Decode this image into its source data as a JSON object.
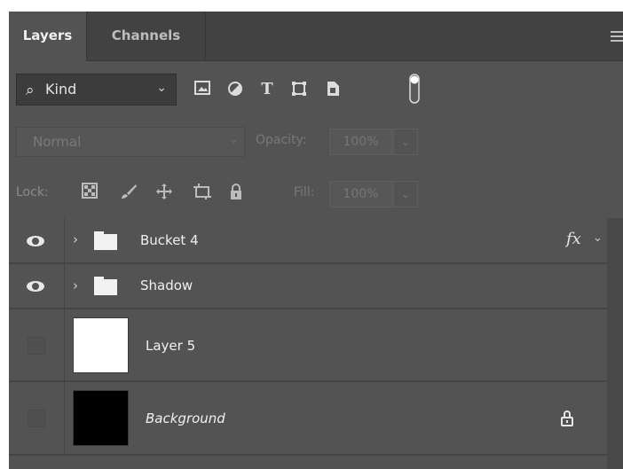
{
  "tabs": {
    "layers": "Layers",
    "channels": "Channels"
  },
  "filter": {
    "kind_label": "Kind",
    "icons": [
      "pixel-filter-icon",
      "adjustment-filter-icon",
      "type-filter-icon",
      "shape-filter-icon",
      "smart-object-filter-icon",
      "filter-toggle-icon"
    ],
    "type_glyph": "T"
  },
  "blend": {
    "mode": "Normal",
    "opacity_label": "Opacity:",
    "opacity_value": "100%"
  },
  "lock": {
    "label": "Lock:",
    "fill_label": "Fill:",
    "fill_value": "100%"
  },
  "layers": [
    {
      "name": "Bucket 4",
      "type": "group",
      "visible": true,
      "fx": "fx"
    },
    {
      "name": "Shadow",
      "type": "group",
      "visible": true
    },
    {
      "name": "Layer 5",
      "type": "pixel",
      "visible": false,
      "thumb": "#ffffff"
    },
    {
      "name": "Background",
      "type": "background",
      "visible": false,
      "thumb": "#000000",
      "locked": true
    }
  ],
  "colors": {
    "panel": "#535353",
    "tabbar": "#424242",
    "divider": "#454545"
  }
}
